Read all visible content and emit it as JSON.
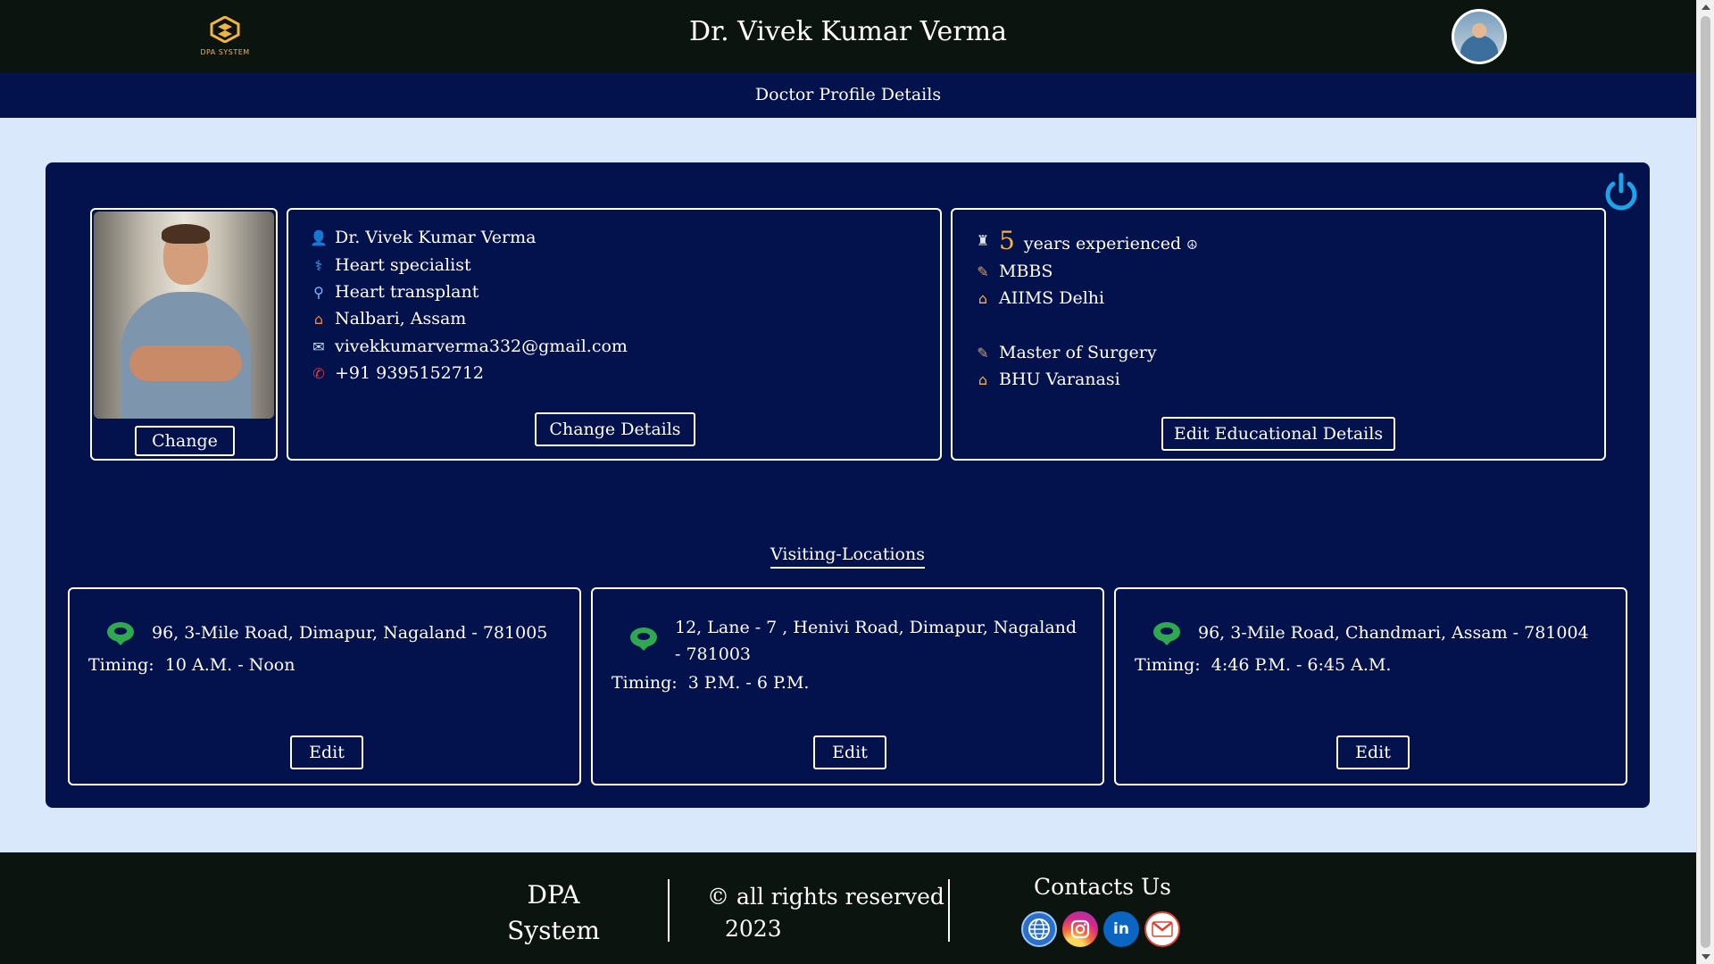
{
  "header": {
    "logo_text": "DPA SYSTEM",
    "title": "Dr. Vivek Kumar Verma",
    "subtitle": "Doctor Profile Details"
  },
  "profile": {
    "change_photo_label": "Change",
    "name": "Dr. Vivek Kumar Verma",
    "specialty": "Heart specialist",
    "expertise": "Heart transplant",
    "location": "Nalbari, Assam",
    "email": "vivekkumarverma332@gmail.com",
    "phone": "+91 9395152712",
    "change_details_label": "Change Details"
  },
  "education": {
    "experience_years": "5",
    "experience_text": "years experienced",
    "experience_symbol": "☮",
    "degrees": [
      {
        "degree": "MBBS",
        "institute": "AIIMS Delhi"
      },
      {
        "degree": "Master of Surgery",
        "institute": "BHU Varanasi"
      }
    ],
    "edit_label": "Edit Educational Details"
  },
  "visiting": {
    "heading": "Visiting-Locations",
    "timing_label": "Timing:",
    "edit_label": "Edit",
    "locations": [
      {
        "address": "96, 3-Mile Road, Dimapur, Nagaland - 781005",
        "timing": "10 A.M. - Noon"
      },
      {
        "address": "12, Lane - 7 , Henivi Road, Dimapur, Nagaland - 781003",
        "timing": "3 P.M. - 6 P.M."
      },
      {
        "address": "96, 3-Mile Road, Chandmari, Assam - 781004",
        "timing": "4:46 P.M. - 6:45 A.M."
      }
    ]
  },
  "footer": {
    "brand_line1": "DPA",
    "brand_line2": "System",
    "rights": "© all rights reserved",
    "year": "2023",
    "contacts": "Contacts Us",
    "social_icons": [
      "globe-icon",
      "instagram-icon",
      "linkedin-icon",
      "gmail-icon"
    ],
    "linkedin_text": "in"
  },
  "colors": {
    "dark_bar": "#0c1410",
    "navy": "#03114d",
    "page_bg": "#d9e8fb",
    "accent_gold": "#f2b441",
    "pin_green": "#2fa84f",
    "power_blue": "#1ea3e6"
  }
}
